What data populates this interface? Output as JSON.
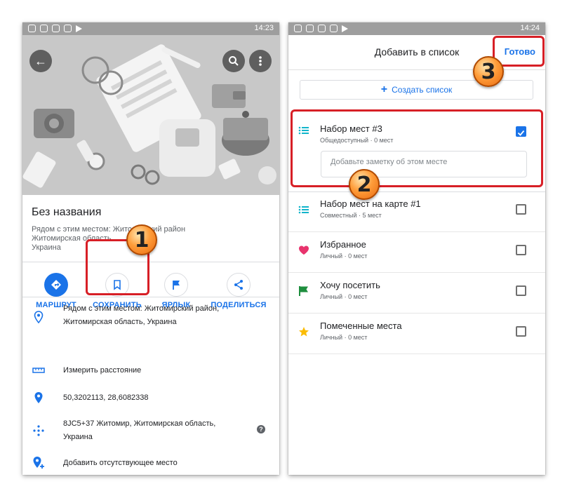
{
  "left_screen": {
    "status_time": "14:23",
    "place": {
      "title": "Без названия",
      "subtitle": "Рядом с этим местом: Житомирский район\nЖитомирская область\nУкраина"
    },
    "actions": [
      {
        "label": "МАРШРУТ",
        "icon": "directions-icon"
      },
      {
        "label": "СОХРАНИТЬ",
        "icon": "bookmark-icon"
      },
      {
        "label": "ЯРЛЫК",
        "icon": "flag-icon"
      },
      {
        "label": "ПОДЕЛИТЬСЯ",
        "icon": "share-icon"
      }
    ],
    "info_rows": [
      {
        "text": "Рядом с этим местом: Житомирский район, Житомирская область, Украина",
        "icon": "location-pin-outline-icon"
      },
      {
        "text": "Измерить расстояние",
        "icon": "ruler-icon"
      },
      {
        "text": "50,3202113, 28,6082338",
        "icon": "location-pin-icon"
      },
      {
        "text": "8JC5+37 Житомир, Житомирская область, Украина",
        "icon": "plus-code-icon"
      },
      {
        "text": "Добавить отсутствующее место",
        "icon": "add-location-icon"
      }
    ]
  },
  "right_screen": {
    "status_time": "14:24",
    "header": {
      "title": "Добавить в список",
      "done_label": "Готово"
    },
    "create_list_label": "Создать список",
    "note_placeholder": "Добавьте заметку об этом месте",
    "lists": [
      {
        "name": "Набор мест #3",
        "meta": "Общедоступный · 0 мест",
        "checked": true,
        "icon": "list-icon"
      },
      {
        "name": "Набор мест на карте #1",
        "meta": "Совместный · 5 мест",
        "checked": false,
        "icon": "list-icon"
      },
      {
        "name": "Избранное",
        "meta": "Личный · 0 мест",
        "checked": false,
        "icon": "heart-icon"
      },
      {
        "name": "Хочу посетить",
        "meta": "Личный · 0 мест",
        "checked": false,
        "icon": "green-flag-icon"
      },
      {
        "name": "Помеченные места",
        "meta": "Личный · 0 мест",
        "checked": false,
        "icon": "star-icon"
      }
    ]
  },
  "annotations": [
    {
      "number": "1"
    },
    {
      "number": "2"
    },
    {
      "number": "3"
    }
  ],
  "colors": {
    "accent": "#1a73e8",
    "highlight": "#d71f26",
    "badge": "#ff9d3a",
    "heart": "#e8336d",
    "flag": "#1e8e3e",
    "star": "#fbbc04",
    "list_icon": "#12b5cb"
  }
}
